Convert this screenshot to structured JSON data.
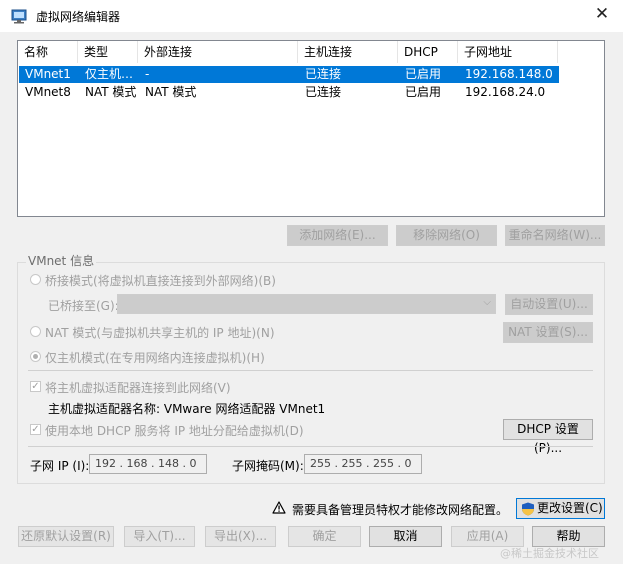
{
  "window": {
    "title": "虚拟网络编辑器",
    "close_glyph": "✕"
  },
  "network_list": {
    "columns": [
      "名称",
      "类型",
      "外部连接",
      "主机连接",
      "DHCP",
      "子网地址"
    ],
    "rows": [
      {
        "name": "VMnet1",
        "type": "仅主机…",
        "external": "-",
        "host": "已连接",
        "dhcp": "已启用",
        "subnet": "192.168.148.0",
        "selected": true
      },
      {
        "name": "VMnet8",
        "type": "NAT 模式",
        "external": "NAT 模式",
        "host": "已连接",
        "dhcp": "已启用",
        "subnet": "192.168.24.0",
        "selected": false
      }
    ]
  },
  "list_buttons": {
    "add": "添加网络(E)...",
    "remove": "移除网络(O)",
    "rename": "重命名网络(W)..."
  },
  "vmnet_info": {
    "legend": "VMnet 信息",
    "bridge_radio": "桥接模式(将虚拟机直接连接到外部网络)(B)",
    "bridged_to_label": "已桥接至(G):",
    "auto_settings": "自动设置(U)...",
    "nat_radio": "NAT 模式(与虚拟机共享主机的 IP 地址)(N)",
    "nat_settings": "NAT 设置(S)...",
    "hostonly_radio": "仅主机模式(在专用网络内连接虚拟机)(H)",
    "connect_adapter_check": "将主机虚拟适配器连接到此网络(V)",
    "adapter_name_label": "主机虚拟适配器名称: VMware 网络适配器 VMnet1",
    "dhcp_check": "使用本地 DHCP 服务将 IP 地址分配给虚拟机(D)",
    "dhcp_settings": "DHCP 设置(P)...",
    "subnet_ip_label": "子网 IP (I):",
    "subnet_ip_value": "192 . 168 . 148 . 0",
    "subnet_mask_label": "子网掩码(M):",
    "subnet_mask_value": "255 . 255 . 255 . 0"
  },
  "admin": {
    "warning_icon": "warning-icon",
    "message": "需要具备管理员特权才能修改网络配置。",
    "change_settings": "更改设置(C)"
  },
  "footer": {
    "restore": "还原默认设置(R)",
    "import": "导入(T)...",
    "export": "导出(X)...",
    "ok": "确定",
    "cancel": "取消",
    "apply": "应用(A)",
    "help": "帮助"
  },
  "watermark": "@稀土掘金技术社区",
  "colors": {
    "selection": "#0078d7",
    "dialog_bg": "#f0f0f0",
    "disabled_text": "#a0a0a0"
  }
}
